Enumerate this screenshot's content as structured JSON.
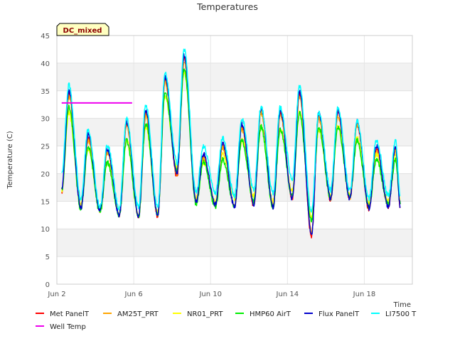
{
  "chart_data": {
    "type": "line",
    "title": "Temperatures",
    "xlabel": "Time",
    "ylabel": "Temperature (C)",
    "ylim": [
      0,
      45
    ],
    "xlim": [
      "2020-06-02",
      "2020-06-20"
    ],
    "yticks": [
      0,
      5,
      10,
      15,
      20,
      25,
      30,
      35,
      40,
      45
    ],
    "xticks": [
      {
        "date": "2020-06-02",
        "label": "Jun 2"
      },
      {
        "date": "2020-06-06",
        "label": "Jun 6"
      },
      {
        "date": "2020-06-10",
        "label": "Jun 10"
      },
      {
        "date": "2020-06-14",
        "label": "Jun 14"
      },
      {
        "date": "2020-06-18",
        "label": "Jun 18"
      }
    ],
    "grid": true,
    "legend_position": "bottom",
    "tag": "DC_mixed",
    "diurnal_extremes": {
      "x": [
        "2020-06-02 06:00",
        "2020-06-02 15:00",
        "2020-06-03 06:00",
        "2020-06-03 15:00",
        "2020-06-04 06:00",
        "2020-06-04 15:00",
        "2020-06-05 06:00",
        "2020-06-05 15:00",
        "2020-06-06 06:00",
        "2020-06-06 15:00",
        "2020-06-07 06:00",
        "2020-06-07 15:00",
        "2020-06-08 06:00",
        "2020-06-08 15:00",
        "2020-06-09 06:00",
        "2020-06-09 15:00",
        "2020-06-10 06:00",
        "2020-06-10 15:00",
        "2020-06-11 06:00",
        "2020-06-11 15:00",
        "2020-06-12 06:00",
        "2020-06-12 15:00",
        "2020-06-13 06:00",
        "2020-06-13 15:00",
        "2020-06-14 06:00",
        "2020-06-14 15:00",
        "2020-06-15 06:00",
        "2020-06-15 15:00",
        "2020-06-16 06:00",
        "2020-06-16 15:00",
        "2020-06-17 06:00",
        "2020-06-17 15:00",
        "2020-06-18 06:00",
        "2020-06-18 15:00",
        "2020-06-19 06:00",
        "2020-06-19 15:00",
        "2020-06-19 21:00"
      ],
      "series": [
        {
          "name": "Met PanelT",
          "color": "#ff0000",
          "values": [
            16.5,
            34.5,
            14.0,
            26.5,
            13.3,
            24.0,
            12.5,
            29.0,
            12.3,
            31.0,
            12.3,
            37.0,
            19.5,
            41.0,
            15.0,
            23.0,
            14.5,
            25.0,
            14.0,
            28.5,
            14.3,
            31.5,
            14.0,
            31.0,
            15.5,
            34.5,
            8.7,
            30.5,
            15.3,
            31.0,
            15.5,
            29.0,
            13.5,
            24.5,
            14.0,
            24.5,
            14.0
          ]
        },
        {
          "name": "AM25T_PRT",
          "color": "#ffa500",
          "values": [
            16.3,
            34.0,
            14.0,
            26.0,
            13.3,
            23.8,
            12.5,
            28.8,
            12.3,
            30.5,
            12.5,
            36.5,
            20.0,
            40.5,
            15.2,
            22.8,
            14.5,
            24.8,
            14.2,
            28.0,
            14.5,
            31.0,
            14.2,
            30.5,
            15.8,
            34.0,
            9.5,
            30.0,
            15.5,
            30.5,
            15.7,
            28.8,
            14.0,
            24.0,
            14.5,
            24.0,
            14.5
          ]
        },
        {
          "name": "NR01_PRT",
          "color": "#ffff00",
          "values": [
            17.0,
            31.0,
            14.5,
            24.5,
            13.5,
            22.0,
            12.8,
            26.0,
            12.5,
            28.5,
            13.0,
            34.0,
            21.0,
            38.5,
            15.5,
            22.0,
            15.0,
            23.5,
            15.5,
            26.0,
            16.0,
            28.5,
            15.0,
            28.0,
            17.0,
            31.0,
            12.0,
            28.0,
            16.0,
            28.5,
            16.0,
            26.5,
            14.5,
            23.5,
            15.0,
            23.5,
            15.0
          ]
        },
        {
          "name": "HMP60 AirT",
          "color": "#00ee00",
          "values": [
            17.0,
            32.0,
            13.5,
            24.8,
            13.0,
            22.0,
            12.5,
            26.0,
            12.2,
            29.0,
            12.5,
            34.5,
            20.5,
            39.0,
            14.5,
            22.0,
            14.0,
            22.5,
            14.2,
            26.0,
            15.0,
            28.5,
            14.0,
            28.0,
            16.0,
            31.0,
            11.5,
            28.5,
            15.5,
            28.5,
            15.8,
            26.0,
            14.0,
            22.5,
            14.5,
            22.5,
            14.5
          ]
        },
        {
          "name": "Flux PanelT",
          "color": "#0000cc",
          "values": [
            17.0,
            35.0,
            13.8,
            27.0,
            13.3,
            24.5,
            12.5,
            29.5,
            12.3,
            31.5,
            12.3,
            37.5,
            20.0,
            41.5,
            15.0,
            23.5,
            14.5,
            25.5,
            14.0,
            29.0,
            14.5,
            32.0,
            14.0,
            31.5,
            15.5,
            35.0,
            9.0,
            31.0,
            15.5,
            31.5,
            15.5,
            29.5,
            13.8,
            25.0,
            14.0,
            25.0,
            14.0
          ]
        },
        {
          "name": "LI7500 T",
          "color": "#00ffff",
          "values": [
            20.0,
            36.0,
            15.5,
            28.0,
            14.0,
            25.2,
            13.8,
            30.0,
            14.0,
            32.5,
            14.0,
            38.2,
            22.0,
            42.5,
            16.5,
            25.0,
            16.5,
            26.5,
            16.0,
            30.0,
            17.0,
            32.0,
            16.5,
            32.0,
            19.0,
            36.0,
            13.0,
            31.0,
            17.0,
            32.0,
            17.0,
            29.5,
            15.5,
            26.0,
            16.0,
            26.0,
            16.0
          ]
        }
      ]
    },
    "well_temp": {
      "name": "Well Temp",
      "color": "#ee00ee",
      "x": [
        "2020-06-02 06:00",
        "2020-06-05 22:00"
      ],
      "values": [
        32.8,
        32.8
      ]
    },
    "legend": [
      {
        "name": "Met PanelT",
        "color": "#ff0000"
      },
      {
        "name": "AM25T_PRT",
        "color": "#ffa500"
      },
      {
        "name": "NR01_PRT",
        "color": "#ffff00"
      },
      {
        "name": "HMP60 AirT",
        "color": "#00ee00"
      },
      {
        "name": "Flux PanelT",
        "color": "#0000cc"
      },
      {
        "name": "LI7500 T",
        "color": "#00ffff"
      },
      {
        "name": "Well Temp",
        "color": "#ee00ee"
      }
    ]
  }
}
